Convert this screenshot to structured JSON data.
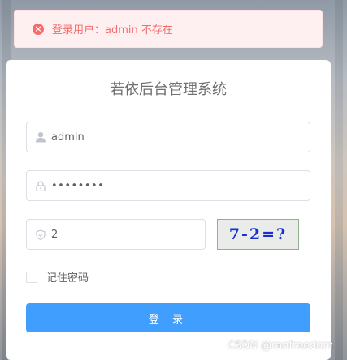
{
  "alert": {
    "message": "登录用户：admin 不存在",
    "icon": "error-icon"
  },
  "login": {
    "title": "若依后台管理系统",
    "username": {
      "value": "admin",
      "icon": "user-icon"
    },
    "password": {
      "masked_value": "••••••••",
      "icon": "lock-icon"
    },
    "captcha": {
      "value": "2",
      "icon": "shield-icon",
      "image_text": "7-2=?"
    },
    "remember_label": "记住密码",
    "submit_label": "登 录"
  },
  "watermark": "CSDN @ranfreedom",
  "colors": {
    "primary": "#409eff",
    "error": "#f56c6c",
    "error_bg": "#fef0f0"
  }
}
